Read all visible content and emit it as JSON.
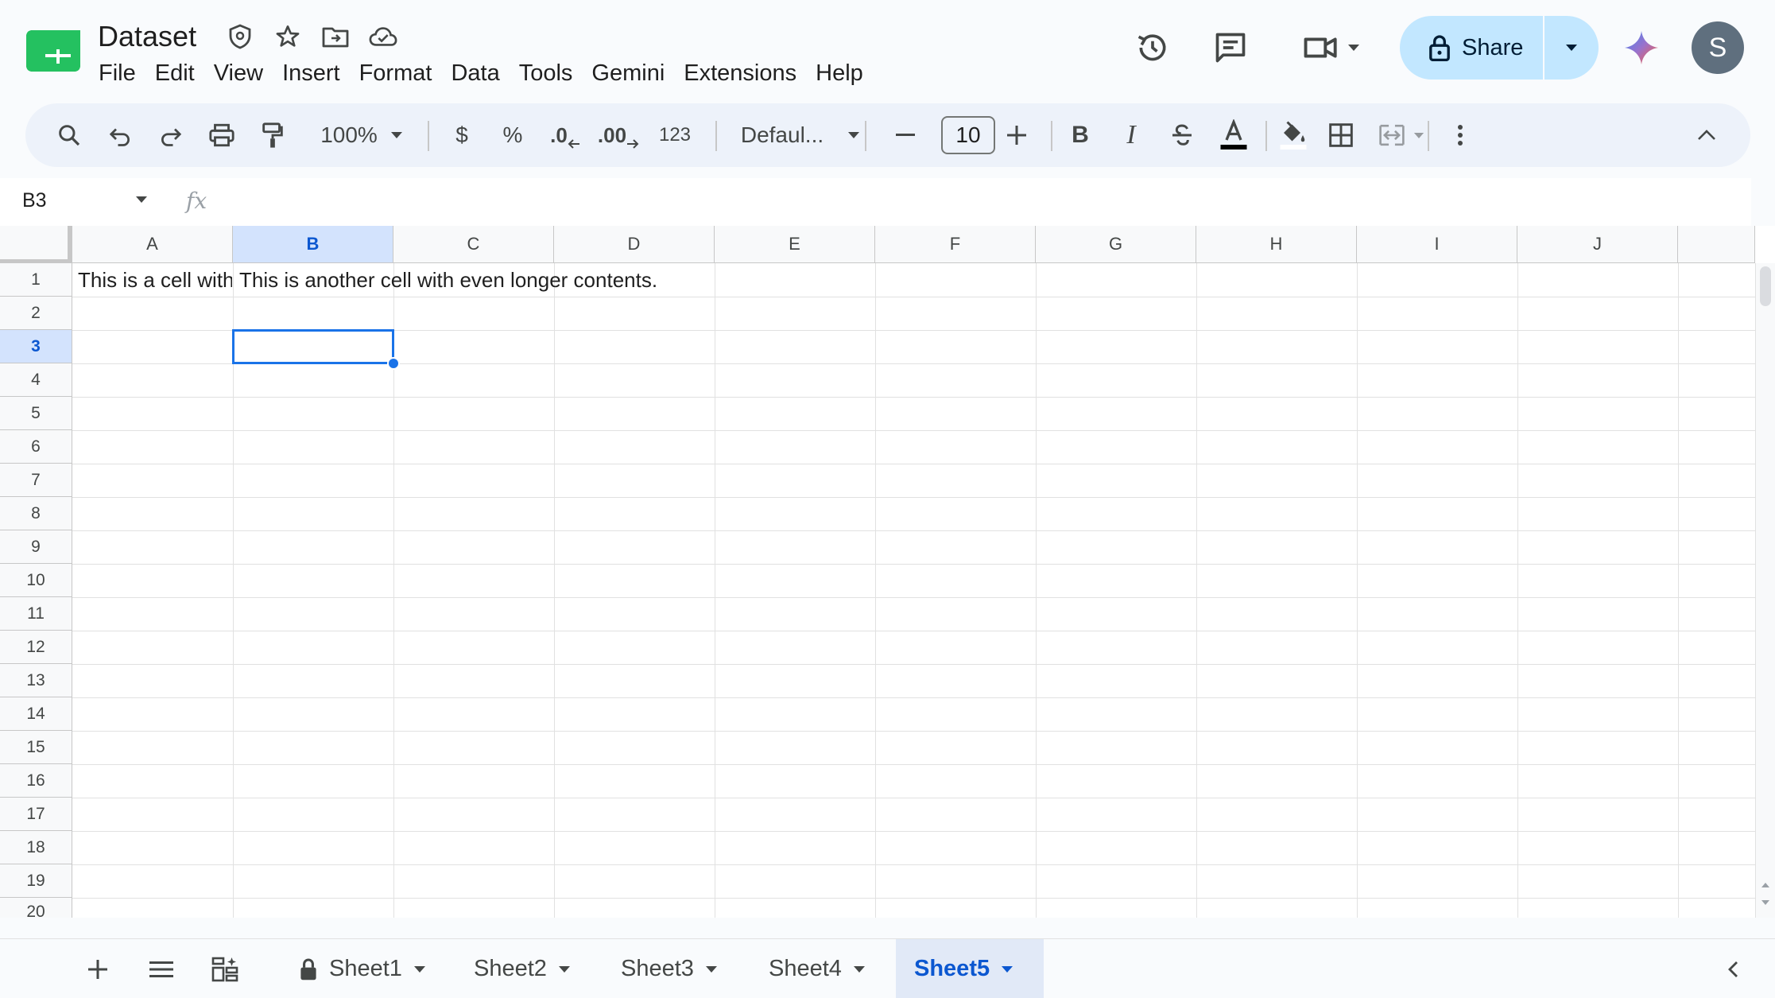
{
  "app": {
    "title": "Dataset",
    "menu": [
      "File",
      "Edit",
      "View",
      "Insert",
      "Format",
      "Data",
      "Tools",
      "Gemini",
      "Extensions",
      "Help"
    ],
    "share_label": "Share",
    "avatar_initial": "S"
  },
  "toolbar": {
    "zoom": "100%",
    "currency": "$",
    "percent": "%",
    "decrease_decimals": ".0",
    "increase_decimals": ".00",
    "more_formats": "123",
    "font": "Defaul...",
    "font_size": "10",
    "bold": "B",
    "italic": "I"
  },
  "formula_bar": {
    "name_box": "B3",
    "fx": "fx",
    "value": ""
  },
  "grid": {
    "columns": [
      "A",
      "B",
      "C",
      "D",
      "E",
      "F",
      "G",
      "H",
      "I",
      "J"
    ],
    "selected_column": "B",
    "rows": [
      "1",
      "2",
      "3",
      "4",
      "5",
      "6",
      "7",
      "8",
      "9",
      "10",
      "11",
      "12",
      "13",
      "14",
      "15",
      "16",
      "17",
      "18",
      "19",
      "20"
    ],
    "selected_row": "3",
    "cells": {
      "A1": "This is a cell with",
      "B1": "This is another cell with even longer contents."
    },
    "selected_cell": "B3"
  },
  "sheets": {
    "tabs": [
      {
        "label": "Sheet1",
        "locked": true,
        "active": false
      },
      {
        "label": "Sheet2",
        "locked": false,
        "active": false
      },
      {
        "label": "Sheet3",
        "locked": false,
        "active": false
      },
      {
        "label": "Sheet4",
        "locked": false,
        "active": false
      },
      {
        "label": "Sheet5",
        "locked": false,
        "active": true
      }
    ]
  },
  "colors": {
    "accent": "#0b57d0",
    "selection": "#1a73e8",
    "share_bg": "#c2e7ff",
    "logo_green": "#0f9d58"
  }
}
